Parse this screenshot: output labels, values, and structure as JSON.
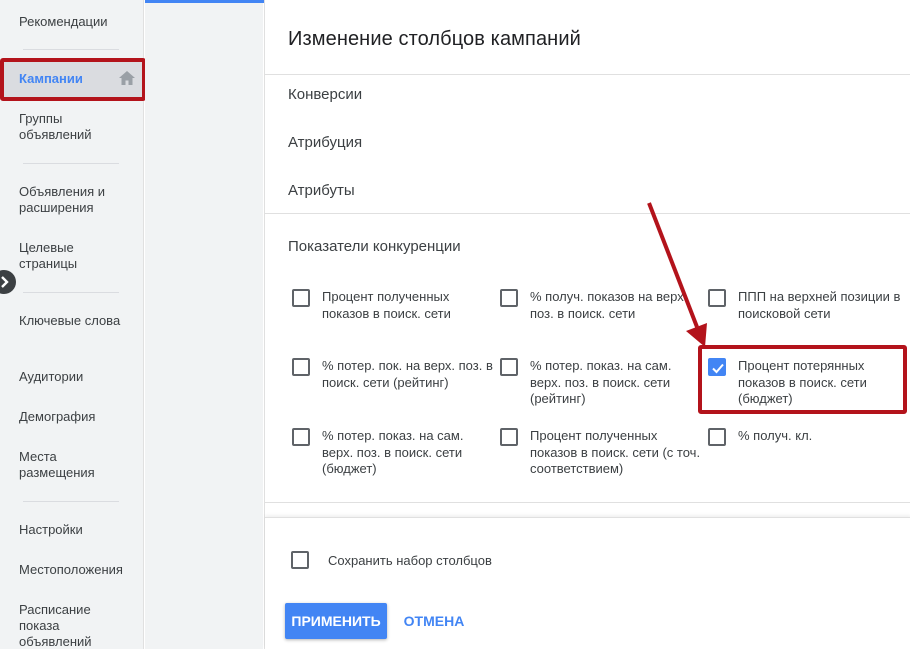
{
  "sidebar": {
    "items": [
      {
        "label": "Рекомендации"
      },
      {
        "label": "Кампании",
        "active": true
      },
      {
        "label": "Группы объявлений"
      },
      {
        "label": "Объявления и расширения"
      },
      {
        "label": "Целевые страницы"
      },
      {
        "label": "Ключевые слова"
      },
      {
        "label": "Аудитории"
      },
      {
        "label": "Демография"
      },
      {
        "label": "Места размещения"
      },
      {
        "label": "Настройки"
      },
      {
        "label": "Местоположения"
      },
      {
        "label": "Расписание показа объявлений"
      }
    ]
  },
  "dialog": {
    "title": "Изменение столбцов кампаний",
    "sections": [
      {
        "label": "Конверсии"
      },
      {
        "label": "Атрибуция"
      },
      {
        "label": "Атрибуты"
      }
    ],
    "group": {
      "title": "Показатели конкуренции",
      "options": [
        {
          "label": "Процент полученных показов в поиск. сети",
          "checked": false
        },
        {
          "label": "% получ. показов на верх. поз. в поиск. сети",
          "checked": false
        },
        {
          "label": "ППП на верхней позиции в поисковой сети",
          "checked": false
        },
        {
          "label": "% потер. пок. на верх. поз. в поиск. сети (рейтинг)",
          "checked": false
        },
        {
          "label": "% потер. показ. на сам. верх. поз. в поиск. сети (рейтинг)",
          "checked": false
        },
        {
          "label": "Процент потерянных показов в поиск. сети (бюджет)",
          "checked": true
        },
        {
          "label": "% потер. показ. на сам. верх. поз. в поиск. сети (бюджет)",
          "checked": false
        },
        {
          "label": "Процент полученных показов в поиск. сети (с точ. соответствием)",
          "checked": false
        },
        {
          "label": "% получ. кл.",
          "checked": false
        }
      ]
    },
    "footer": {
      "save_label": "Сохранить набор столбцов",
      "apply_label": "ПРИМЕНИТЬ",
      "cancel_label": "ОТМЕНА"
    }
  },
  "colors": {
    "accent": "#4285f4",
    "annotation": "#b3131b"
  },
  "icons": {
    "home": "home-icon",
    "collapse": "chevron-right-icon",
    "check": "check-icon"
  }
}
